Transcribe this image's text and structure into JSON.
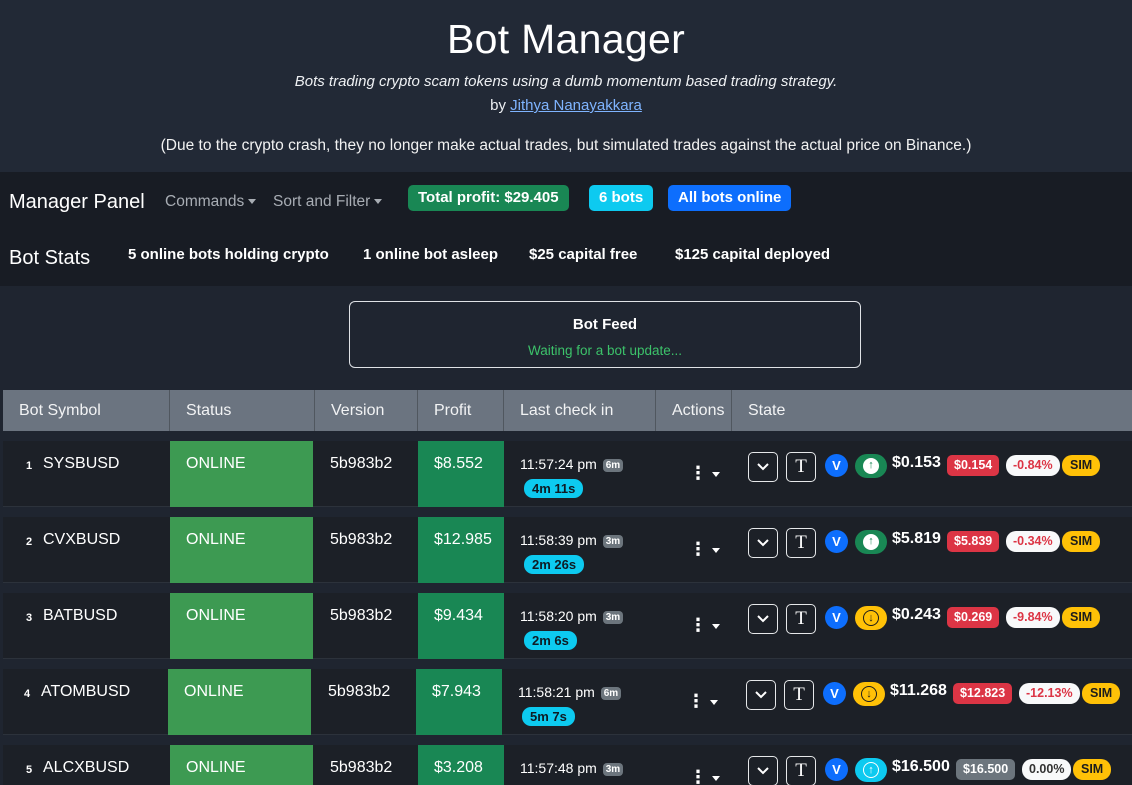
{
  "header": {
    "title": "Bot Manager",
    "subtitle": "Bots trading crypto scam tokens using a dumb momentum based trading strategy.",
    "by_prefix": "by",
    "author": "Jithya Nanayakkara",
    "note": "(Due to the crypto crash, they no longer make actual trades, but simulated trades against the actual price on Binance.)"
  },
  "manager_panel": {
    "title": "Manager Panel",
    "commands_label": "Commands",
    "sort_filter_label": "Sort and Filter",
    "total_profit": "Total profit: $29.405",
    "bot_count": "6 bots",
    "online_status": "All bots online"
  },
  "bot_stats": {
    "title": "Bot Stats",
    "holding": "5 online bots holding crypto",
    "asleep": "1 online bot asleep",
    "capital_free": "$25 capital free",
    "capital_deployed": "$125 capital deployed"
  },
  "feed": {
    "title": "Bot Feed",
    "status": "Waiting for a bot update..."
  },
  "table": {
    "headers": [
      "Bot Symbol",
      "Status",
      "Version",
      "Profit",
      "Last check in",
      "Actions",
      "State"
    ],
    "rows": [
      {
        "index": "1",
        "symbol": "SYSBUSD",
        "status": "ONLINE",
        "version": "5b983b2",
        "profit": "$8.552",
        "time": "11:57:24 pm",
        "time_badge": "6m",
        "ago": "4m 11s",
        "v": "V",
        "trend": "up",
        "price": "$0.153",
        "buy_price": "$0.154",
        "change": "-0.84%",
        "sim": "SIM"
      },
      {
        "index": "2",
        "symbol": "CVXBUSD",
        "status": "ONLINE",
        "version": "5b983b2",
        "profit": "$12.985",
        "time": "11:58:39 pm",
        "time_badge": "3m",
        "ago": "2m 26s",
        "v": "V",
        "trend": "up",
        "price": "$5.819",
        "buy_price": "$5.839",
        "change": "-0.34%",
        "sim": "SIM"
      },
      {
        "index": "3",
        "symbol": "BATBUSD",
        "status": "ONLINE",
        "version": "5b983b2",
        "profit": "$9.434",
        "time": "11:58:20 pm",
        "time_badge": "3m",
        "ago": "2m 6s",
        "v": "V",
        "trend": "down",
        "price": "$0.243",
        "buy_price": "$0.269",
        "change": "-9.84%",
        "sim": "SIM"
      },
      {
        "index": "4",
        "symbol": "ATOMBUSD",
        "status": "ONLINE",
        "version": "5b983b2",
        "profit": "$7.943",
        "time": "11:58:21 pm",
        "time_badge": "6m",
        "ago": "5m 7s",
        "v": "V",
        "trend": "down",
        "price": "$11.268",
        "buy_price": "$12.823",
        "change": "-12.13%",
        "sim": "SIM"
      },
      {
        "index": "5",
        "symbol": "ALCXBUSD",
        "status": "ONLINE",
        "version": "5b983b2",
        "profit": "$3.208",
        "time": "11:57:48 pm",
        "time_badge": "3m",
        "ago": "",
        "v": "V",
        "trend": "neutral-up",
        "price": "$16.500",
        "buy_price": "$16.500",
        "change": "0.00%",
        "sim": "SIM"
      }
    ]
  },
  "colors": {
    "success": "#198754",
    "info": "#0dcaf0",
    "primary": "#0d6efd",
    "danger": "#dc3545",
    "warning": "#ffc107",
    "secondary": "#6c757d"
  },
  "icons": {
    "expand": "chevron-down-icon",
    "tools": "t-icon",
    "up": "arrow-up-circle-icon",
    "down": "arrow-down-circle-icon",
    "menu": "kebab-menu-icon"
  }
}
